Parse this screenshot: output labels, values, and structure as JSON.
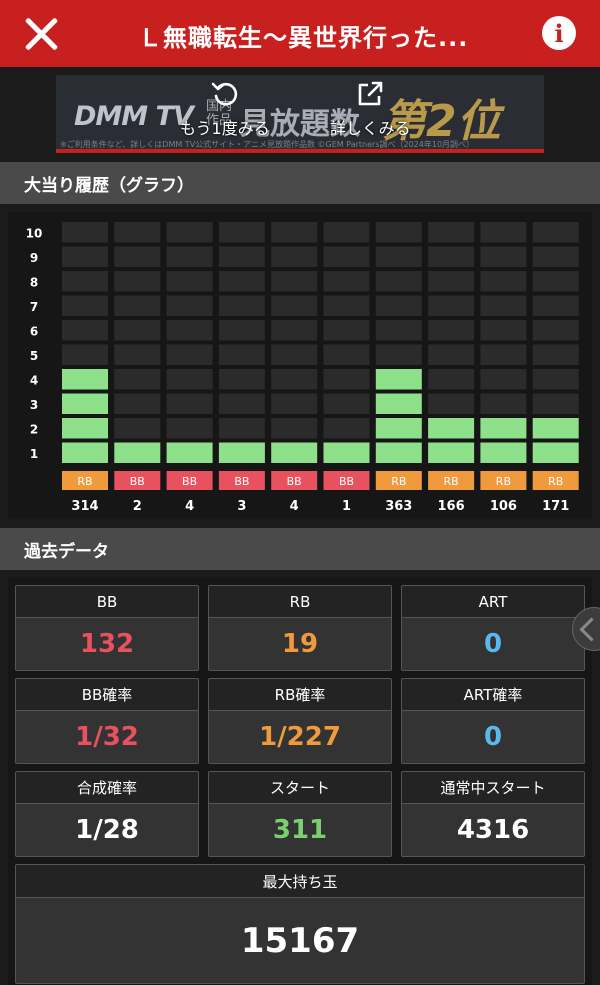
{
  "header": {
    "title": "Ｌ無職転生～異世界行った..."
  },
  "ad": {
    "logo": "DMM TV",
    "sub_line1": "国内",
    "sub_line2": "作品",
    "main": "見放題数",
    "rank": "第2位",
    "fine_print": "※ご利用条件など、詳しくはDMM TV公式サイト・アニメ見放題作品数 ©GEM Partners調べ（2024年10月調べ）",
    "replay_label": "もう1度みる",
    "more_label": "詳しくみる"
  },
  "graph_section": {
    "title": "大当り履歴（グラフ）"
  },
  "past_section": {
    "title": "過去データ"
  },
  "colors": {
    "bar": "#8ee08a",
    "rb_tag": "#f09a3e",
    "bb_tag": "#e8515e",
    "bb_value": "#e8515e",
    "rb_value": "#f09a3e",
    "art_value": "#5ab8ec",
    "start_value": "#7ad06e"
  },
  "chart_data": {
    "type": "bar",
    "y_ticks": [
      "1",
      "2",
      "3",
      "4",
      "5",
      "6",
      "7",
      "8",
      "9",
      "10"
    ],
    "ylim": [
      0,
      10
    ],
    "categories": [
      "314",
      "2",
      "4",
      "3",
      "4",
      "1",
      "363",
      "166",
      "106",
      "171"
    ],
    "values": [
      4,
      1,
      1,
      1,
      1,
      1,
      4,
      2,
      2,
      2
    ],
    "types": [
      "RB",
      "BB",
      "BB",
      "BB",
      "BB",
      "BB",
      "RB",
      "RB",
      "RB",
      "RB"
    ]
  },
  "stats": {
    "bb": {
      "label": "BB",
      "value": "132"
    },
    "rb": {
      "label": "RB",
      "value": "19"
    },
    "art": {
      "label": "ART",
      "value": "0"
    },
    "bb_rate": {
      "label": "BB確率",
      "value": "1/32"
    },
    "rb_rate": {
      "label": "RB確率",
      "value": "1/227"
    },
    "art_rate": {
      "label": "ART確率",
      "value": "0"
    },
    "combined_rate": {
      "label": "合成確率",
      "value": "1/28"
    },
    "start": {
      "label": "スタート",
      "value": "311"
    },
    "normal_start": {
      "label": "通常中スタート",
      "value": "4316"
    },
    "max_balls": {
      "label": "最大持ち玉",
      "value": "15167"
    }
  }
}
